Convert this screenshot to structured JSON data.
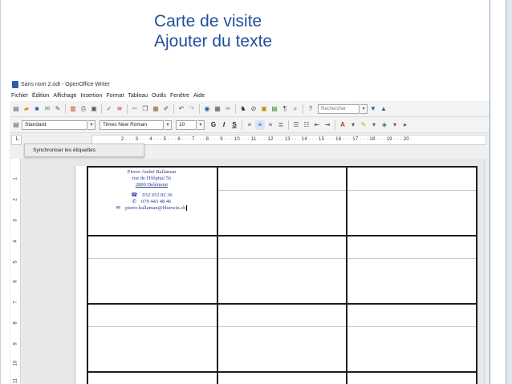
{
  "slide": {
    "title_line1": "Carte de visite",
    "title_line2": "Ajouter du texte"
  },
  "window": {
    "title": "Sans nom 2.odt - OpenOffice Writer"
  },
  "menu": [
    "Fichier",
    "Édition",
    "Affichage",
    "Insertion",
    "Format",
    "Tableau",
    "Outils",
    "Fenêtre",
    "Aide"
  ],
  "toolbar": {
    "search_placeholder": "Rechercher"
  },
  "format_bar": {
    "style": "Standard",
    "font": "Times New Roman",
    "size": "10",
    "bold": "G",
    "italic": "I",
    "underline": "S"
  },
  "ruler": {
    "marks": "2 · · · 3 · · · 4 · · · 5 · · · 6 · · · 7 · · · 8 · · · 9 · · · 10 · · · 11 · · · 12 · · · 13 · · · 14 · · · 15 · · · 16 · · · 17 · · · 18 · · · 19 · · · 20 ·",
    "vertical": [
      "1",
      "2",
      "3",
      "4",
      "5",
      "6",
      "7",
      "8",
      "9",
      "10",
      "11"
    ]
  },
  "sync_button": {
    "label": "Synchroniser les étiquettes"
  },
  "card": {
    "name": "Pierre-André Ballaman",
    "street": "rue de l'Hôpital 56",
    "city": "2800 Delémont",
    "phone": "032 652 82 36",
    "mobile": "079 443 48 46",
    "email": "pierre.ballaman@bluewin.ch"
  },
  "colors": {
    "title": "#1f4e9b",
    "card_text": "#2a3b8f"
  }
}
